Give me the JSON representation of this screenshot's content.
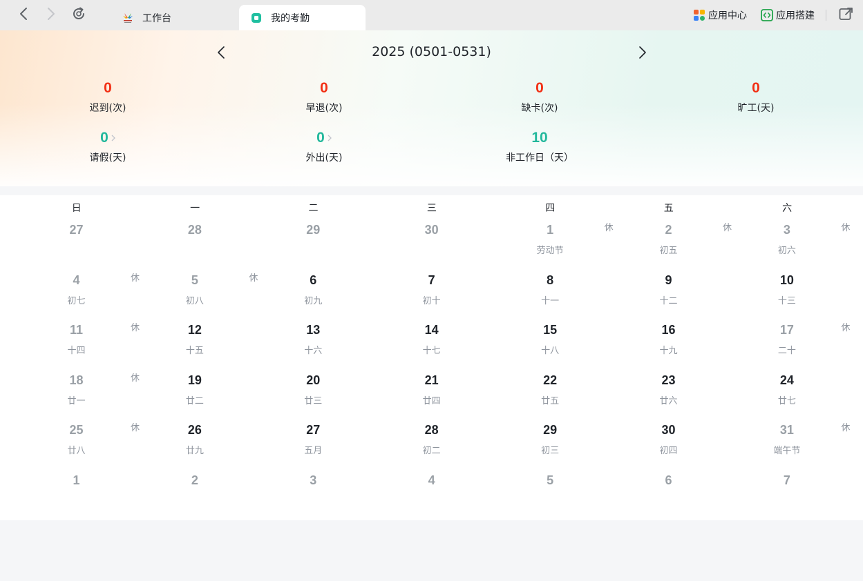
{
  "tabs": {
    "inactive_label": "工作台",
    "active_label": "我的考勤"
  },
  "actions": {
    "app_center": "应用中心",
    "app_builder": "应用搭建"
  },
  "period": "2025 (0501-0531)",
  "stats": [
    {
      "value": "0",
      "label": "迟到(次)",
      "color": "#f22f14"
    },
    {
      "value": "0",
      "label": "早退(次)",
      "color": "#f22f14"
    },
    {
      "value": "0",
      "label": "缺卡(次)",
      "color": "#f22f14"
    },
    {
      "value": "0",
      "label": "旷工(天)",
      "color": "#f22f14"
    },
    {
      "value": "0",
      "label": "请假(天)",
      "color": "#23b89c"
    },
    {
      "value": "0",
      "label": "外出(天)",
      "color": "#23b89c"
    },
    {
      "value": "10",
      "label": "非工作日（天）",
      "color": "#23b89c"
    }
  ],
  "weekdays": [
    "日",
    "一",
    "二",
    "三",
    "四",
    "五",
    "六"
  ],
  "rest_label": "休",
  "weeks": [
    [
      {
        "day": "27",
        "lunar": "",
        "muted": true,
        "rest": false
      },
      {
        "day": "28",
        "lunar": "",
        "muted": true,
        "rest": false
      },
      {
        "day": "29",
        "lunar": "",
        "muted": true,
        "rest": false
      },
      {
        "day": "30",
        "lunar": "",
        "muted": true,
        "rest": false
      },
      {
        "day": "1",
        "lunar": "劳动节",
        "muted": true,
        "rest": true
      },
      {
        "day": "2",
        "lunar": "初五",
        "muted": true,
        "rest": true
      },
      {
        "day": "3",
        "lunar": "初六",
        "muted": true,
        "rest": true
      }
    ],
    [
      {
        "day": "4",
        "lunar": "初七",
        "muted": true,
        "rest": true
      },
      {
        "day": "5",
        "lunar": "初八",
        "muted": true,
        "rest": true
      },
      {
        "day": "6",
        "lunar": "初九",
        "muted": false,
        "rest": false
      },
      {
        "day": "7",
        "lunar": "初十",
        "muted": false,
        "rest": false
      },
      {
        "day": "8",
        "lunar": "十一",
        "muted": false,
        "rest": false
      },
      {
        "day": "9",
        "lunar": "十二",
        "muted": false,
        "rest": false
      },
      {
        "day": "10",
        "lunar": "十三",
        "muted": false,
        "rest": false
      }
    ],
    [
      {
        "day": "11",
        "lunar": "十四",
        "muted": true,
        "rest": true
      },
      {
        "day": "12",
        "lunar": "十五",
        "muted": false,
        "rest": false
      },
      {
        "day": "13",
        "lunar": "十六",
        "muted": false,
        "rest": false
      },
      {
        "day": "14",
        "lunar": "十七",
        "muted": false,
        "rest": false
      },
      {
        "day": "15",
        "lunar": "十八",
        "muted": false,
        "rest": false
      },
      {
        "day": "16",
        "lunar": "十九",
        "muted": false,
        "rest": false
      },
      {
        "day": "17",
        "lunar": "二十",
        "muted": true,
        "rest": true
      }
    ],
    [
      {
        "day": "18",
        "lunar": "廿一",
        "muted": true,
        "rest": true
      },
      {
        "day": "19",
        "lunar": "廿二",
        "muted": false,
        "rest": false
      },
      {
        "day": "20",
        "lunar": "廿三",
        "muted": false,
        "rest": false
      },
      {
        "day": "21",
        "lunar": "廿四",
        "muted": false,
        "rest": false
      },
      {
        "day": "22",
        "lunar": "廿五",
        "muted": false,
        "rest": false
      },
      {
        "day": "23",
        "lunar": "廿六",
        "muted": false,
        "rest": false
      },
      {
        "day": "24",
        "lunar": "廿七",
        "muted": false,
        "rest": false
      }
    ],
    [
      {
        "day": "25",
        "lunar": "廿八",
        "muted": true,
        "rest": true
      },
      {
        "day": "26",
        "lunar": "廿九",
        "muted": false,
        "rest": false
      },
      {
        "day": "27",
        "lunar": "五月",
        "muted": false,
        "rest": false
      },
      {
        "day": "28",
        "lunar": "初二",
        "muted": false,
        "rest": false
      },
      {
        "day": "29",
        "lunar": "初三",
        "muted": false,
        "rest": false
      },
      {
        "day": "30",
        "lunar": "初四",
        "muted": false,
        "rest": false
      },
      {
        "day": "31",
        "lunar": "端午节",
        "muted": true,
        "rest": true
      }
    ],
    [
      {
        "day": "1",
        "lunar": "",
        "muted": true,
        "rest": false
      },
      {
        "day": "2",
        "lunar": "",
        "muted": true,
        "rest": false
      },
      {
        "day": "3",
        "lunar": "",
        "muted": true,
        "rest": false
      },
      {
        "day": "4",
        "lunar": "",
        "muted": true,
        "rest": false
      },
      {
        "day": "5",
        "lunar": "",
        "muted": true,
        "rest": false
      },
      {
        "day": "6",
        "lunar": "",
        "muted": true,
        "rest": false
      },
      {
        "day": "7",
        "lunar": "",
        "muted": true,
        "rest": false
      }
    ]
  ]
}
